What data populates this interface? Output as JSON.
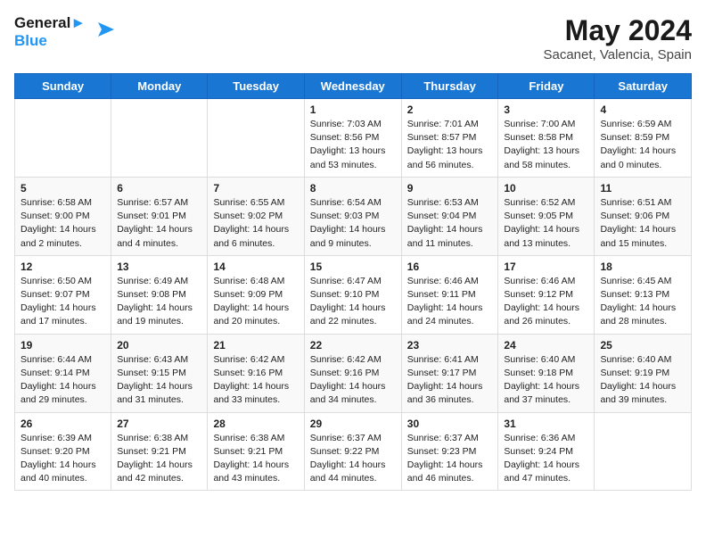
{
  "header": {
    "logo_line1": "General",
    "logo_line2": "Blue",
    "month_title": "May 2024",
    "location": "Sacanet, Valencia, Spain"
  },
  "weekdays": [
    "Sunday",
    "Monday",
    "Tuesday",
    "Wednesday",
    "Thursday",
    "Friday",
    "Saturday"
  ],
  "weeks": [
    [
      null,
      null,
      null,
      {
        "day": "1",
        "sunrise": "7:03 AM",
        "sunset": "8:56 PM",
        "daylight": "13 hours and 53 minutes."
      },
      {
        "day": "2",
        "sunrise": "7:01 AM",
        "sunset": "8:57 PM",
        "daylight": "13 hours and 56 minutes."
      },
      {
        "day": "3",
        "sunrise": "7:00 AM",
        "sunset": "8:58 PM",
        "daylight": "13 hours and 58 minutes."
      },
      {
        "day": "4",
        "sunrise": "6:59 AM",
        "sunset": "8:59 PM",
        "daylight": "14 hours and 0 minutes."
      }
    ],
    [
      {
        "day": "5",
        "sunrise": "6:58 AM",
        "sunset": "9:00 PM",
        "daylight": "14 hours and 2 minutes."
      },
      {
        "day": "6",
        "sunrise": "6:57 AM",
        "sunset": "9:01 PM",
        "daylight": "14 hours and 4 minutes."
      },
      {
        "day": "7",
        "sunrise": "6:55 AM",
        "sunset": "9:02 PM",
        "daylight": "14 hours and 6 minutes."
      },
      {
        "day": "8",
        "sunrise": "6:54 AM",
        "sunset": "9:03 PM",
        "daylight": "14 hours and 9 minutes."
      },
      {
        "day": "9",
        "sunrise": "6:53 AM",
        "sunset": "9:04 PM",
        "daylight": "14 hours and 11 minutes."
      },
      {
        "day": "10",
        "sunrise": "6:52 AM",
        "sunset": "9:05 PM",
        "daylight": "14 hours and 13 minutes."
      },
      {
        "day": "11",
        "sunrise": "6:51 AM",
        "sunset": "9:06 PM",
        "daylight": "14 hours and 15 minutes."
      }
    ],
    [
      {
        "day": "12",
        "sunrise": "6:50 AM",
        "sunset": "9:07 PM",
        "daylight": "14 hours and 17 minutes."
      },
      {
        "day": "13",
        "sunrise": "6:49 AM",
        "sunset": "9:08 PM",
        "daylight": "14 hours and 19 minutes."
      },
      {
        "day": "14",
        "sunrise": "6:48 AM",
        "sunset": "9:09 PM",
        "daylight": "14 hours and 20 minutes."
      },
      {
        "day": "15",
        "sunrise": "6:47 AM",
        "sunset": "9:10 PM",
        "daylight": "14 hours and 22 minutes."
      },
      {
        "day": "16",
        "sunrise": "6:46 AM",
        "sunset": "9:11 PM",
        "daylight": "14 hours and 24 minutes."
      },
      {
        "day": "17",
        "sunrise": "6:46 AM",
        "sunset": "9:12 PM",
        "daylight": "14 hours and 26 minutes."
      },
      {
        "day": "18",
        "sunrise": "6:45 AM",
        "sunset": "9:13 PM",
        "daylight": "14 hours and 28 minutes."
      }
    ],
    [
      {
        "day": "19",
        "sunrise": "6:44 AM",
        "sunset": "9:14 PM",
        "daylight": "14 hours and 29 minutes."
      },
      {
        "day": "20",
        "sunrise": "6:43 AM",
        "sunset": "9:15 PM",
        "daylight": "14 hours and 31 minutes."
      },
      {
        "day": "21",
        "sunrise": "6:42 AM",
        "sunset": "9:16 PM",
        "daylight": "14 hours and 33 minutes."
      },
      {
        "day": "22",
        "sunrise": "6:42 AM",
        "sunset": "9:16 PM",
        "daylight": "14 hours and 34 minutes."
      },
      {
        "day": "23",
        "sunrise": "6:41 AM",
        "sunset": "9:17 PM",
        "daylight": "14 hours and 36 minutes."
      },
      {
        "day": "24",
        "sunrise": "6:40 AM",
        "sunset": "9:18 PM",
        "daylight": "14 hours and 37 minutes."
      },
      {
        "day": "25",
        "sunrise": "6:40 AM",
        "sunset": "9:19 PM",
        "daylight": "14 hours and 39 minutes."
      }
    ],
    [
      {
        "day": "26",
        "sunrise": "6:39 AM",
        "sunset": "9:20 PM",
        "daylight": "14 hours and 40 minutes."
      },
      {
        "day": "27",
        "sunrise": "6:38 AM",
        "sunset": "9:21 PM",
        "daylight": "14 hours and 42 minutes."
      },
      {
        "day": "28",
        "sunrise": "6:38 AM",
        "sunset": "9:21 PM",
        "daylight": "14 hours and 43 minutes."
      },
      {
        "day": "29",
        "sunrise": "6:37 AM",
        "sunset": "9:22 PM",
        "daylight": "14 hours and 44 minutes."
      },
      {
        "day": "30",
        "sunrise": "6:37 AM",
        "sunset": "9:23 PM",
        "daylight": "14 hours and 46 minutes."
      },
      {
        "day": "31",
        "sunrise": "6:36 AM",
        "sunset": "9:24 PM",
        "daylight": "14 hours and 47 minutes."
      },
      null
    ]
  ],
  "labels": {
    "sunrise_prefix": "Sunrise: ",
    "sunset_prefix": "Sunset: ",
    "daylight_prefix": "Daylight: "
  }
}
